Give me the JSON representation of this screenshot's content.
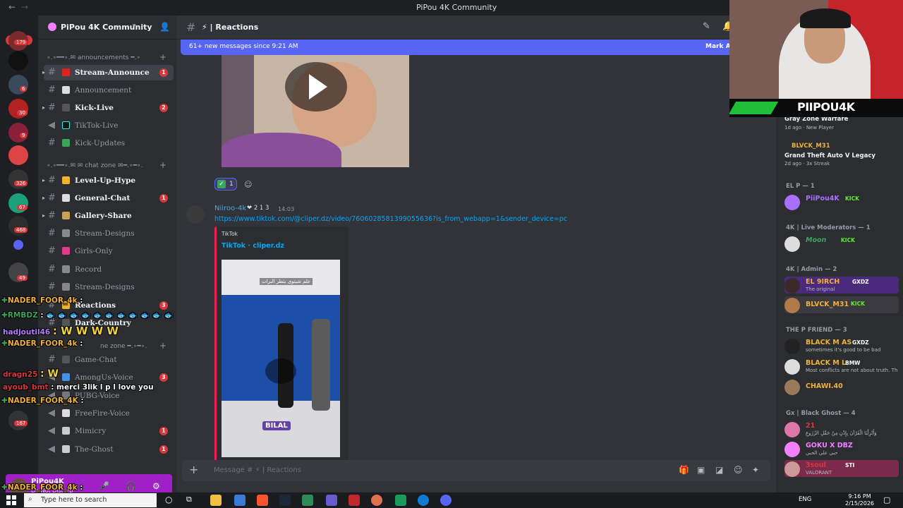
{
  "window": {
    "title": "PiPou 4K Community"
  },
  "rail": {
    "new_label": "NEW",
    "badges": [
      "179",
      "6",
      "30",
      "9",
      "326",
      "67",
      "468",
      "49",
      "167"
    ]
  },
  "server": {
    "name": "PiPou 4K Community"
  },
  "categories": {
    "announcements": "∘.∘━━∘.✉ announcements ━.∘",
    "chat_zone": "∘.∘━━∘.✉ ✉ chat zone ✉━.∘━∘.",
    "voice_zone": "ne zone ━.∘━∘."
  },
  "channels": [
    {
      "label": "Stream-Announce",
      "count": "1",
      "unread": true
    },
    {
      "label": "Announcement",
      "count": "",
      "unread": false
    },
    {
      "label": "Kick-Live",
      "count": "2",
      "unread": true
    },
    {
      "label": "TikTok-Live",
      "count": "",
      "unread": false
    },
    {
      "label": "Kick-Updates",
      "count": "",
      "unread": false
    },
    {
      "label": "Level-Up-Hype",
      "count": "",
      "unread": true
    },
    {
      "label": "General-Chat",
      "count": "1",
      "unread": true
    },
    {
      "label": "Gallery-Share",
      "count": "",
      "unread": true
    },
    {
      "label": "Stream-Designs",
      "count": "",
      "unread": false
    },
    {
      "label": "Girls-Only",
      "count": "",
      "unread": false
    },
    {
      "label": "Record",
      "count": "",
      "unread": false
    },
    {
      "label": "Stream-Designs",
      "count": "",
      "unread": false
    },
    {
      "label": "Reactions",
      "count": "3",
      "unread": true
    },
    {
      "label": "Dark-Country",
      "count": "",
      "unread": true
    },
    {
      "label": "Game-Chat",
      "count": "",
      "unread": false
    },
    {
      "label": "AmongUs-Voice",
      "count": "3",
      "unread": false
    },
    {
      "label": "PUBG-Voice",
      "count": "",
      "unread": false
    },
    {
      "label": "FreeFire-Voice",
      "count": "",
      "unread": false
    },
    {
      "label": "Mimicry",
      "count": "1",
      "unread": false
    },
    {
      "label": "The-Ghost",
      "count": "1",
      "unread": false
    }
  ],
  "user_panel": {
    "name": "PiPou4K",
    "status": "Do Not Disturb"
  },
  "chat": {
    "channel_name": "Reactions",
    "new_messages": "61+ new messages since 9:21 AM",
    "mark_as_read": "Mark As",
    "reaction_count": "1",
    "message": {
      "author": "Niiroo-4k",
      "tag": "❤ 2 1 3",
      "time": "14:03",
      "link": "https://www.tiktok.com/@cliper.dz/video/7606028581399055636?is_from_webapp=1&sender_device=pc",
      "embed_provider": "TikTok",
      "embed_title": "TikTok · cliper.dz",
      "embed_caption": "علم شيتوى بتطر البرات",
      "embed_tag": "BILAL"
    },
    "composer_placeholder": "Message # ⚡ | Reactions"
  },
  "members": {
    "game1": {
      "title": "Gray Zone Warfare",
      "sub": "1d ago · New Player"
    },
    "blvck_name": "BLVCK_M31",
    "game2": {
      "title": "Grand Theft Auto V Legacy",
      "sub": "2d ago · 3x Streak"
    },
    "groups": [
      {
        "label": "EL P — 1"
      },
      {
        "label": "4K | Live Moderators — 1"
      },
      {
        "label": "4K | Admin — 2"
      },
      {
        "label": "THE P FRIEND — 3"
      },
      {
        "label": "Gx | Black Ghost — 4"
      }
    ],
    "rows": [
      {
        "name": "PiiPou4K",
        "tag": "KICK",
        "sub": "",
        "color": "#a970ff"
      },
      {
        "name": "Moon",
        "tag": "KICK",
        "sub": "",
        "color": "#3ba55c"
      },
      {
        "name": "EL 9IRCH",
        "tag": "GXDZ",
        "sub": "The original",
        "color": "#f0b232"
      },
      {
        "name": "BLVCK_M31",
        "tag": "KICK",
        "sub": "",
        "color": "#f0b232"
      },
      {
        "name": "BLACK M AS",
        "tag": "GXDZ",
        "sub": "sometimes it's good to be bad",
        "color": "#f0b232"
      },
      {
        "name": "BLACK M L",
        "tag": "BMW",
        "sub": "Most conflicts are not about truth. Th",
        "color": "#f0b232"
      },
      {
        "name": "CHAWI.40",
        "tag": "",
        "sub": "",
        "color": "#f0b232"
      },
      {
        "name": "21",
        "tag": "",
        "sub": "وَأَنْزِلْنَا الْقُرْآنَ بِإِذْنِ مِنْ حَقْلِ الزُرُوعِ",
        "color": "#da373c"
      },
      {
        "name": "GOKU X DBZ",
        "tag": "",
        "sub": "حبي على الحبي",
        "color": "#f47fff"
      },
      {
        "name": "3soul",
        "tag": "STI",
        "sub": "VALORANT",
        "color": "#da373c"
      }
    ]
  },
  "overlay": {
    "cam_banner": "PIIPOU4K",
    "lines": [
      {
        "user": "NADER_FOOR_4k",
        "text": ":",
        "color": "#f0b232"
      },
      {
        "user": "RMBDZ",
        "text": ":",
        "color": "#3ba55c"
      },
      {
        "user": "hadjoutil46",
        "text": ": W W W W",
        "color": "#b57bff"
      },
      {
        "user": "NADER_FOOR_4k",
        "text": ":",
        "color": "#f0b232"
      },
      {
        "user": "dragn25",
        "text": ": W",
        "color": "#da373c"
      },
      {
        "user": "ayoub_bmt",
        "text": ": merci 3lik l p l love you",
        "color": "#da373c"
      },
      {
        "user": "NADER_FOOR_4K",
        "text": ":",
        "color": "#f0b232"
      },
      {
        "user": "NADER_FOOR_4k",
        "text": ":",
        "color": "#f0b232"
      }
    ]
  },
  "taskbar": {
    "search_placeholder": "Type here to search",
    "lang": "ENG",
    "time": "9:16 PM",
    "date": "2/15/2026"
  }
}
